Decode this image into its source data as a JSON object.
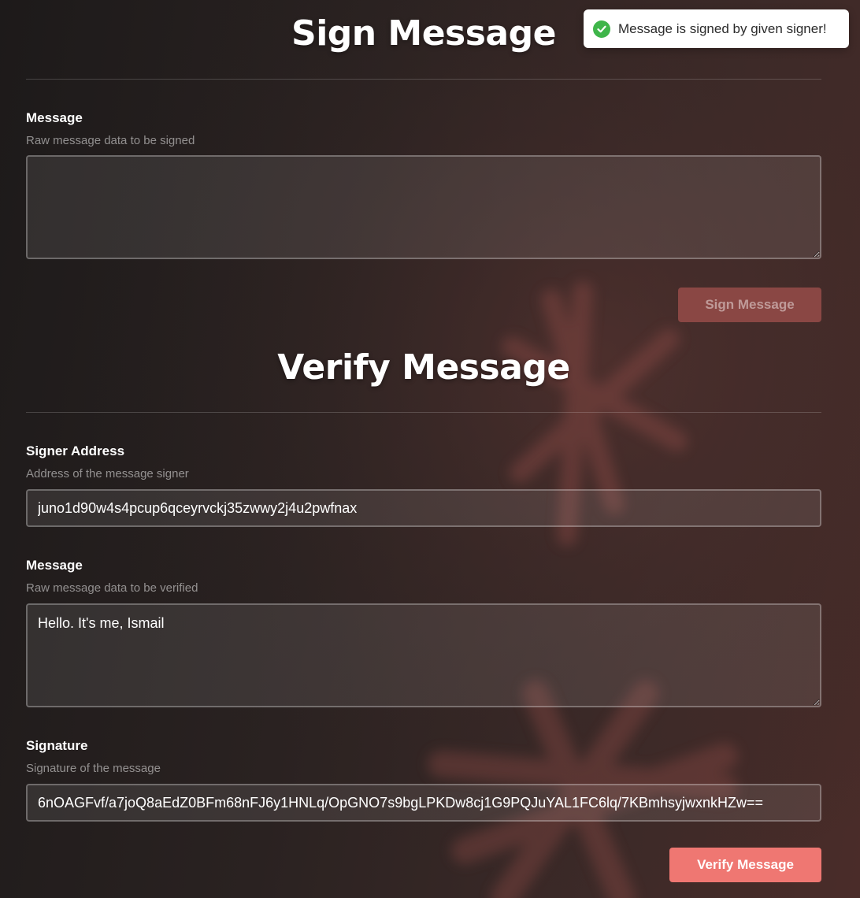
{
  "toast": {
    "message": "Message is signed by given signer!",
    "status_color": "#3fb54a",
    "icon": "check-circle-icon"
  },
  "sign": {
    "title": "Sign Message",
    "message_label": "Message",
    "message_hint": "Raw message data to be signed",
    "message_value": "",
    "button_label": "Sign Message",
    "button_disabled": true
  },
  "verify": {
    "title": "Verify Message",
    "signer_label": "Signer Address",
    "signer_hint": "Address of the message signer",
    "signer_value": "juno1d90w4s4pcup6qceyrvckj35zwwy2j4u2pwfnax",
    "message_label": "Message",
    "message_hint": "Raw message data to be verified",
    "message_value": "Hello. It's me, Ismail",
    "signature_label": "Signature",
    "signature_hint": "Signature of the message",
    "signature_value": "6nOAGFvf/a7joQ8aEdZ0BFm68nFJ6y1HNLq/OpGNO7s9bgLPKDw8cj1G9PQJuYAL1FC6lq/7KBmhsyjwxnkHZw==",
    "button_label": "Verify Message"
  },
  "colors": {
    "accent": "#ef7772",
    "accent_disabled": "#8a4744",
    "background": "#2a2221"
  }
}
